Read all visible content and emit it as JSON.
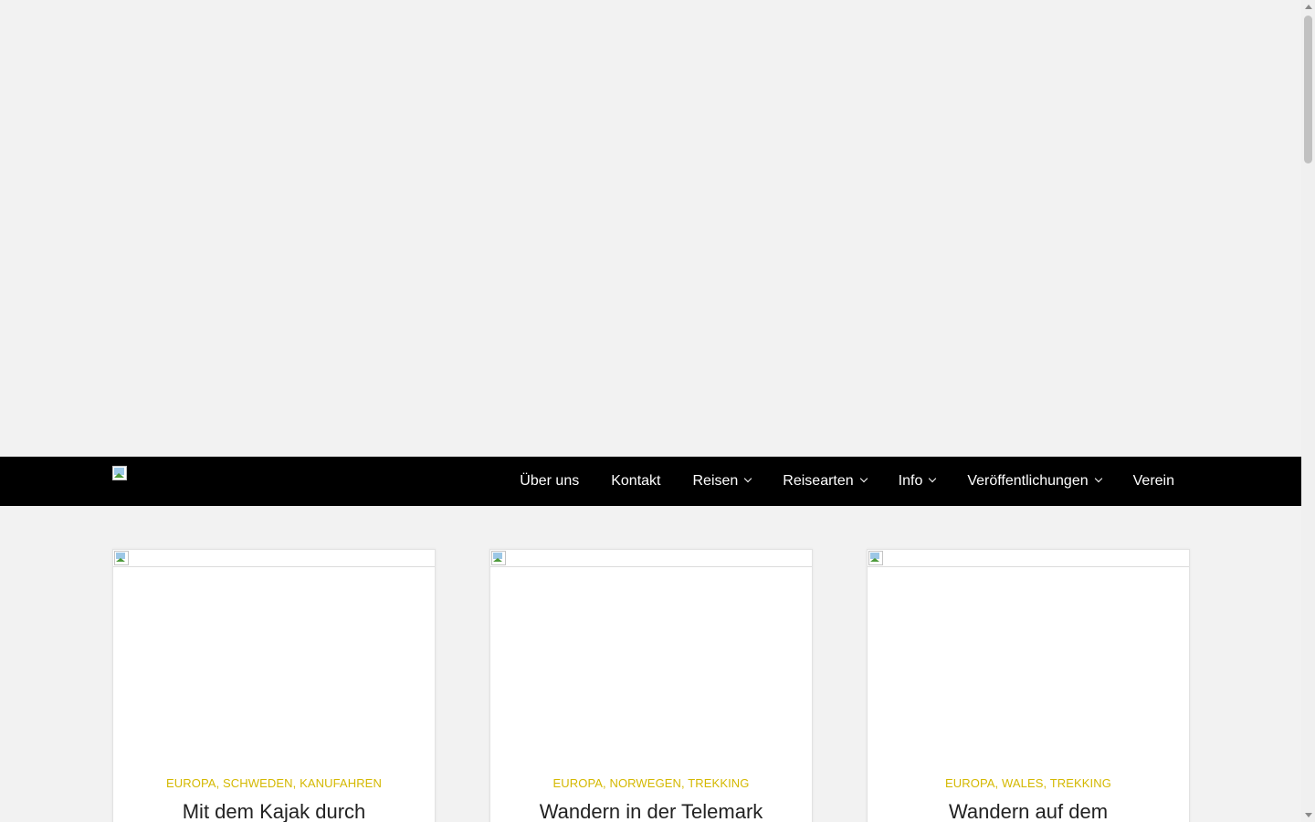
{
  "nav": {
    "items": [
      {
        "label": "Über uns",
        "has_dropdown": false
      },
      {
        "label": "Kontakt",
        "has_dropdown": false
      },
      {
        "label": "Reisen",
        "has_dropdown": true
      },
      {
        "label": "Reisearten",
        "has_dropdown": true
      },
      {
        "label": "Info",
        "has_dropdown": true
      },
      {
        "label": "Veröffentlichungen",
        "has_dropdown": true
      },
      {
        "label": "Verein",
        "has_dropdown": false
      }
    ]
  },
  "posts": [
    {
      "categories": [
        {
          "label": "EUROPA"
        },
        {
          "label": "SCHWEDEN"
        },
        {
          "label": "KANUFAHREN"
        }
      ],
      "title": "Mit dem Kajak durch"
    },
    {
      "categories": [
        {
          "label": "EUROPA"
        },
        {
          "label": "NORWEGEN"
        },
        {
          "label": "TREKKING"
        }
      ],
      "title": "Wandern in der Telemark"
    },
    {
      "categories": [
        {
          "label": "EUROPA"
        },
        {
          "label": "WALES"
        },
        {
          "label": "TREKKING"
        }
      ],
      "title": "Wandern auf dem"
    }
  ],
  "colors": {
    "page_background": "#f2f2f2",
    "navbar_background": "#000000",
    "nav_text": "#ffffff",
    "category_accent": "#d4b800",
    "title_text": "#222222"
  },
  "icons": {
    "logo": "broken-image-icon",
    "dropdown": "chevron-down-icon",
    "post_thumbnail": "broken-image-icon"
  }
}
